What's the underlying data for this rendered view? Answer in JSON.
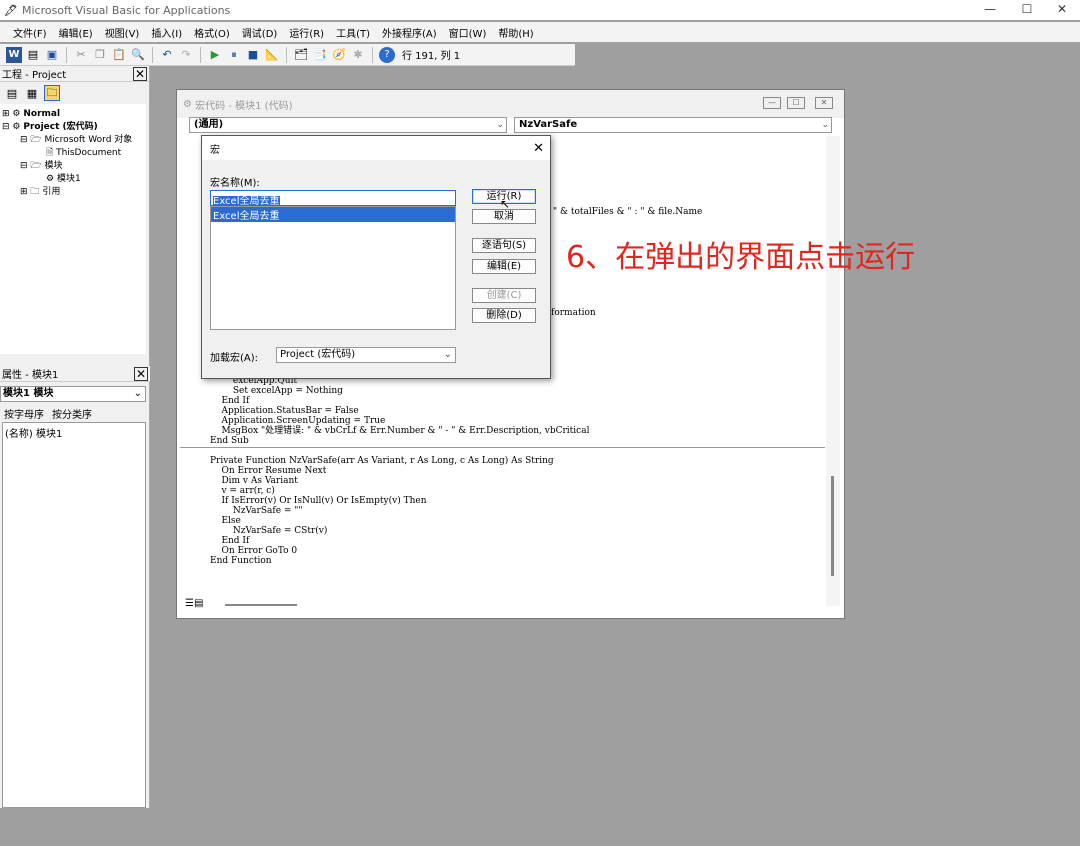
{
  "window": {
    "title": "Microsoft Visual Basic for Applications",
    "min": "—",
    "max": "☐",
    "close": "✕"
  },
  "menu": [
    "文件(F)",
    "编辑(E)",
    "视图(V)",
    "插入(I)",
    "格式(O)",
    "调试(D)",
    "运行(R)",
    "工具(T)",
    "外接程序(A)",
    "窗口(W)",
    "帮助(H)"
  ],
  "toolbar": {
    "position": "行 191, 列 1"
  },
  "project": {
    "title": "工程 - Project",
    "items": [
      "Normal",
      "Project (宏代码)",
      "Microsoft Word 对象",
      "ThisDocument",
      "模块",
      "模块1",
      "引用"
    ]
  },
  "properties": {
    "title": "属性 - 模块1",
    "object": "模块1 模块",
    "tabs": [
      "按字母序",
      "按分类序"
    ],
    "row": "(名称) 模块1"
  },
  "codewin": {
    "title": "宏代码 - 模块1 (代码)",
    "combo_left": "(通用)",
    "combo_right": "NzVarSafe"
  },
  "code": {
    "top_frag1": "\" & totalFiles & \" : \" & file.Name",
    "top_frag2": "formation",
    "lines": [
      "        excelApp.Quit",
      "        Set excelApp = Nothing",
      "    End If",
      "    Application.StatusBar = False",
      "    Application.ScreenUpdating = True",
      "    MsgBox \"处理错误: \" & vbCrLf & Err.Number & \" - \" & Err.Description, vbCritical",
      "End Sub",
      "",
      "Private Function NzVarSafe(arr As Variant, r As Long, c As Long) As String",
      "    On Error Resume Next",
      "    Dim v As Variant",
      "    v = arr(r, c)",
      "    If IsError(v) Or IsNull(v) Or IsEmpty(v) Then",
      "        NzVarSafe = \"\"",
      "    Else",
      "        NzVarSafe = CStr(v)",
      "    End If",
      "    On Error GoTo 0",
      "End Function"
    ]
  },
  "dialog": {
    "title": "宏",
    "name_label": "宏名称(M):",
    "name_value": "Excel全局去重",
    "list": [
      "Excel全局去重"
    ],
    "buttons": {
      "run": "运行(R)",
      "cancel": "取消",
      "step": "逐语句(S)",
      "edit": "编辑(E)",
      "create": "创建(C)",
      "delete": "删除(D)"
    },
    "macros_in_label": "加载宏(A):",
    "macros_in_value": "Project (宏代码)"
  },
  "annotation": "6、在弹出的界面点击运行"
}
